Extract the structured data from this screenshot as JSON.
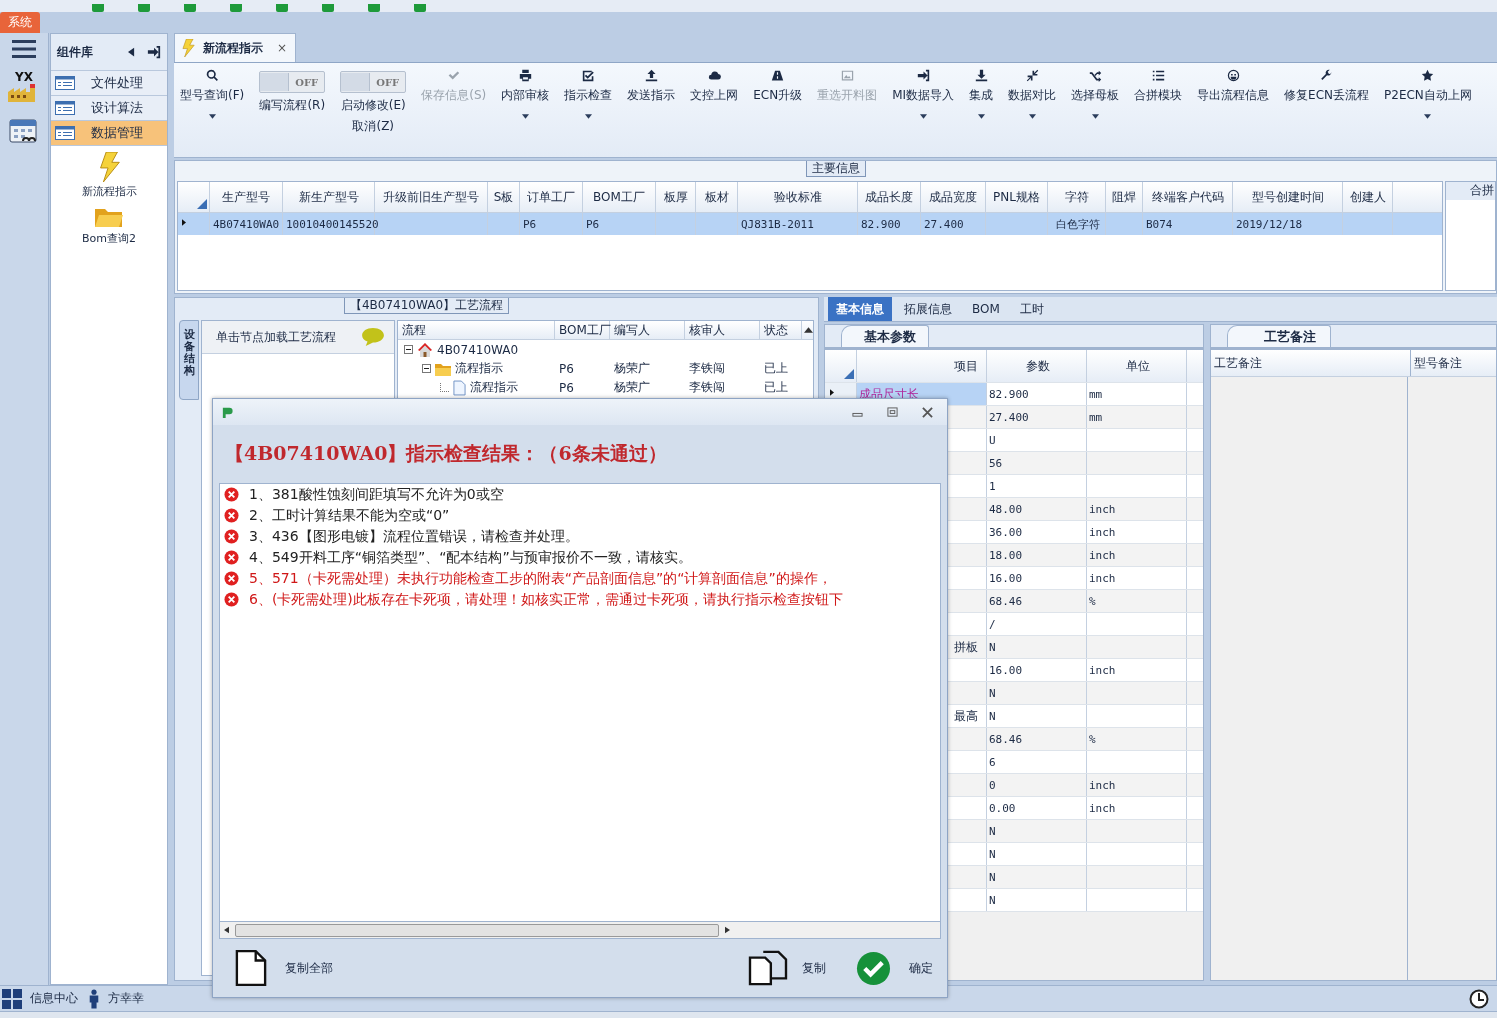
{
  "menu_tab": "系统",
  "rail_logo_text": "YX",
  "component_library": {
    "title": "组件库",
    "categories": [
      {
        "label": "文件处理",
        "selected": false
      },
      {
        "label": "设计算法",
        "selected": false
      },
      {
        "label": "数据管理",
        "selected": true
      }
    ],
    "shortcuts": [
      {
        "label": "新流程指示",
        "kind": "lightning"
      },
      {
        "label": "Bom查询2",
        "kind": "folder"
      }
    ]
  },
  "document_tab": {
    "title": "新流程指示",
    "close": "×"
  },
  "ribbon": [
    {
      "kind": "button",
      "label": "型号查询(F)",
      "dropdown": true,
      "disabled": false
    },
    {
      "kind": "toggle",
      "label": "编写流程(R)",
      "state": "OFF",
      "on": false
    },
    {
      "kind": "toggle",
      "label": "启动修改(E)",
      "sublabel": "取消(Z)",
      "state": "OFF",
      "on": false
    },
    {
      "kind": "button",
      "label": "保存信息(S)",
      "dropdown": false,
      "disabled": true
    },
    {
      "kind": "button",
      "label": "内部审核",
      "dropdown": true,
      "disabled": false
    },
    {
      "kind": "button",
      "label": "指示检查",
      "dropdown": true,
      "disabled": false
    },
    {
      "kind": "button",
      "label": "发送指示",
      "dropdown": false,
      "disabled": false
    },
    {
      "kind": "button",
      "label": "文控上网",
      "dropdown": false,
      "disabled": false
    },
    {
      "kind": "button",
      "label": "ECN升级",
      "dropdown": false,
      "disabled": false
    },
    {
      "kind": "button",
      "label": "重选开料图",
      "dropdown": false,
      "disabled": true
    },
    {
      "kind": "button",
      "label": "MI数据导入",
      "dropdown": true,
      "disabled": false
    },
    {
      "kind": "button",
      "label": "集成",
      "dropdown": true,
      "disabled": false
    },
    {
      "kind": "button",
      "label": "数据对比",
      "dropdown": true,
      "disabled": false
    },
    {
      "kind": "button",
      "label": "选择母板",
      "dropdown": true,
      "disabled": false
    },
    {
      "kind": "button",
      "label": "合拼模块",
      "dropdown": false,
      "disabled": false
    },
    {
      "kind": "button",
      "label": "导出流程信息",
      "dropdown": false,
      "disabled": false
    },
    {
      "kind": "button",
      "label": "修复ECN丢流程",
      "dropdown": false,
      "disabled": false
    },
    {
      "kind": "button",
      "label": "P2ECN自动上网",
      "dropdown": true,
      "disabled": false
    }
  ],
  "main_info": {
    "title": "主要信息",
    "columns": [
      "生产型号",
      "新生产型号",
      "升级前旧生产型号",
      "S板",
      "订单工厂",
      "BOM工厂",
      "板厚",
      "板材",
      "验收标准",
      "成品长度",
      "成品宽度",
      "PNL规格",
      "字符",
      "阻焊",
      "终端客户代码",
      "型号创建时间",
      "创建人"
    ],
    "rows": [
      {
        "selected": true,
        "cells": [
          "4B07410WA0",
          "10010400145520",
          "",
          "",
          "P6",
          "P6",
          "",
          "",
          "QJ831B-2011",
          "82.900",
          "27.400",
          "",
          "白色字符",
          "",
          "B074",
          "2019/12/18",
          ""
        ]
      }
    ],
    "side_panel_title": "合拼"
  },
  "process_panel": {
    "title": "【4B07410WA0】工艺流程",
    "side_tab": "设备结构",
    "hint": "单击节点加载工艺流程",
    "columns": [
      "流程",
      "BOM工厂",
      "编写人",
      "核审人",
      "状态"
    ],
    "tree": [
      {
        "label": "4B07410WA0",
        "kind": "home",
        "expanded": true,
        "cells": [
          "",
          "",
          "",
          ""
        ],
        "children": [
          {
            "label": "流程指示",
            "kind": "folder",
            "expanded": true,
            "cells": [
              "P6",
              "杨荣广",
              "李铁闯",
              "已上"
            ],
            "children": [
              {
                "label": "流程指示",
                "kind": "file",
                "cells": [
                  "P6",
                  "杨荣广",
                  "李铁闯",
                  "已上"
                ]
              }
            ]
          }
        ]
      }
    ]
  },
  "detail_panel": {
    "tabs": [
      {
        "label": "基本信息",
        "selected": true
      },
      {
        "label": "拓展信息",
        "selected": false
      },
      {
        "label": "BOM",
        "selected": false
      },
      {
        "label": "工时",
        "selected": false
      }
    ],
    "params_title": "基本参数",
    "params_columns": [
      "项目",
      "参数",
      "单位"
    ],
    "params": [
      {
        "item": "成品尺寸长",
        "value": "82.900",
        "unit": "mm",
        "selected": true
      },
      {
        "value": "27.400",
        "unit": "mm",
        "selected": false
      },
      {
        "value": "U",
        "selected": false
      },
      {
        "value": "56",
        "selected": false
      },
      {
        "value": "1",
        "selected": false
      },
      {
        "value": "48.00",
        "unit": "inch",
        "selected": false
      },
      {
        "value": "36.00",
        "unit": "inch",
        "selected": false
      },
      {
        "value": "18.00",
        "unit": "inch",
        "selected": false
      },
      {
        "value": "16.00",
        "unit": "inch",
        "selected": false
      },
      {
        "value": "68.46",
        "unit": "%",
        "selected": false
      },
      {
        "value": "/",
        "selected": false
      },
      {
        "item": "拼板",
        "value": "N",
        "selected": false
      },
      {
        "value": "16.00",
        "unit": "inch",
        "selected": false
      },
      {
        "value": "N",
        "selected": false
      },
      {
        "item": "最高",
        "value": "N",
        "selected": false
      },
      {
        "value": "68.46",
        "unit": "%",
        "selected": false
      },
      {
        "value": "6",
        "selected": false
      },
      {
        "value": "0",
        "unit": "inch",
        "selected": false
      },
      {
        "value": "0.00",
        "unit": "inch",
        "selected": false
      },
      {
        "value": "N",
        "selected": false
      },
      {
        "value": "N",
        "selected": false
      },
      {
        "value": "N",
        "selected": false
      },
      {
        "value": "N",
        "selected": false
      }
    ],
    "notes_title": "工艺备注",
    "notes_columns": [
      "工艺备注",
      "型号备注"
    ]
  },
  "dialog": {
    "heading": "【4B07410WA0】指示检查结果：（6条未通过）",
    "items": [
      {
        "text": "1、381酸性蚀刻间距填写不允许为0或空",
        "critical": false
      },
      {
        "text": "2、工时计算结果不能为空或“0”",
        "critical": false
      },
      {
        "text": "3、436【图形电镀】流程位置错误，请检查并处理。",
        "critical": false
      },
      {
        "text": "4、549开料工序“铜箔类型”、“配本结构”与预审报价不一致，请核实。",
        "critical": false
      },
      {
        "text": "5、571（卡死需处理）未执行功能检查工步的附表“产品剖面信息”的“计算剖面信息”的操作，",
        "critical": true
      },
      {
        "text": "6、(卡死需处理)此板存在卡死项，请处理！如核实正常，需通过卡死项，请执行指示检查按钮下",
        "critical": true
      }
    ],
    "buttons": [
      {
        "label": "复制全部",
        "kind": "copy_all"
      },
      {
        "label": "复制",
        "kind": "copy"
      },
      {
        "label": "确定",
        "kind": "ok"
      }
    ]
  },
  "status_bar": [
    {
      "label": "信息中心",
      "kind": "grid"
    },
    {
      "label": "方幸幸",
      "kind": "person"
    }
  ]
}
